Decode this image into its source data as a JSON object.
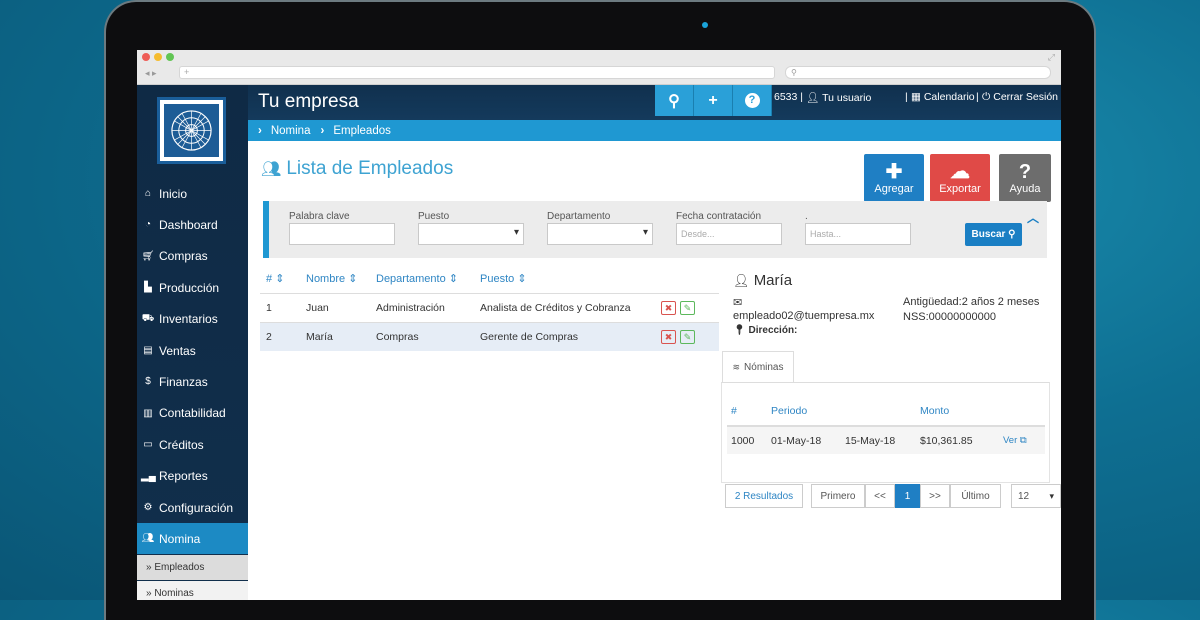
{
  "browser": {
    "url": "+",
    "search": ""
  },
  "app": {
    "brand": "Tu empresa"
  },
  "topbar": {
    "user_count": "6533 |",
    "user": "Tu usuario",
    "calendar": "Calendario",
    "logout": "Cerrar Sesión",
    "separator": "|"
  },
  "sidebar": {
    "items": [
      {
        "label": "Inicio",
        "icon": "home-icon"
      },
      {
        "label": "Dashboard",
        "icon": "dashboard-icon"
      },
      {
        "label": "Compras",
        "icon": "cart-icon"
      },
      {
        "label": "Producción",
        "icon": "factory-icon"
      },
      {
        "label": "Inventarios",
        "icon": "truck-icon"
      },
      {
        "label": "Ventas",
        "icon": "sales-icon"
      },
      {
        "label": "Finanzas",
        "icon": "dollar-icon"
      },
      {
        "label": "Contabilidad",
        "icon": "book-icon"
      },
      {
        "label": "Créditos",
        "icon": "credit-card-icon"
      },
      {
        "label": "Reportes",
        "icon": "bar-chart-icon"
      },
      {
        "label": "Configuración",
        "icon": "gears-icon"
      },
      {
        "label": "Nomina",
        "icon": "users-icon"
      }
    ],
    "sub": [
      "» Empleados",
      "» Nominas"
    ]
  },
  "breadcrumb": [
    "Nomina",
    "Empleados"
  ],
  "page": {
    "title": "Lista de Empleados"
  },
  "actions": {
    "add": "Agregar",
    "export": "Exportar",
    "help": "Ayuda"
  },
  "filters": {
    "keyword_label": "Palabra clave",
    "position_label": "Puesto",
    "department_label": "Departamento",
    "hire_date_label": "Fecha contratación",
    "to_label": ".",
    "from_placeholder": "Desde...",
    "to_placeholder": "Hasta...",
    "search_button": "Buscar"
  },
  "employees": {
    "headers": [
      "#",
      "Nombre",
      "Departamento",
      "Puesto"
    ],
    "rows": [
      {
        "num": "1",
        "name": "Juan",
        "dept": "Administración",
        "position": "Analista de Créditos y Cobranza"
      },
      {
        "num": "2",
        "name": "María",
        "dept": "Compras",
        "position": "Gerente de Compras"
      }
    ]
  },
  "detail": {
    "name": "María",
    "email": "empleado02@tuempresa.mx",
    "address_label": "Dirección:",
    "seniority": "Antigüedad:2 años 2 meses",
    "nss": "NSS:00000000000",
    "tab": "Nóminas"
  },
  "payroll": {
    "headers": [
      "#",
      "Periodo",
      "",
      "Monto",
      ""
    ],
    "row": {
      "num": "1000",
      "start": "01-May-18",
      "end": "15-May-18",
      "amount": "$10,361.85",
      "view": "Ver"
    }
  },
  "pagination": {
    "results": "2 Resultados",
    "first": "Primero",
    "prev": "<<",
    "current": "1",
    "next": ">>",
    "last": "Último",
    "page_size": "12"
  }
}
